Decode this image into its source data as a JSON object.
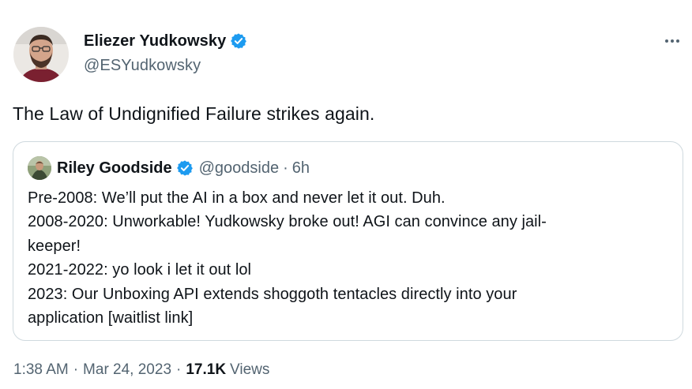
{
  "tweet": {
    "author_name": "Eliezer Yudkowsky",
    "author_handle": "@ESYudkowsky",
    "text": "The Law of Undignified Failure strikes again.",
    "time": "1:38 AM",
    "date": "Mar 24, 2023",
    "separator": "·",
    "views_count": "17.1K",
    "views_label": "Views",
    "more_icon": "more-horizontal-icon",
    "verified_icon": "verified-badge-icon"
  },
  "quoted_tweet": {
    "author_name": "Riley Goodside",
    "author_handle": "@goodside",
    "separator": "·",
    "age": "6h",
    "lines": [
      "Pre-2008: We’ll put the AI in a box and never let it out. Duh.",
      "2008-2020: Unworkable! Yudkowsky broke out! AGI can convince any jail-",
      "keeper!",
      "2021-2022: yo look i let it out lol",
      "2023: Our Unboxing API extends shoggoth tentacles directly into your",
      "application [waitlist link]"
    ]
  },
  "colors": {
    "text_primary": "#0f1419",
    "text_secondary": "#536471",
    "verified_blue": "#1d9bf0",
    "border": "#cfd9de"
  }
}
